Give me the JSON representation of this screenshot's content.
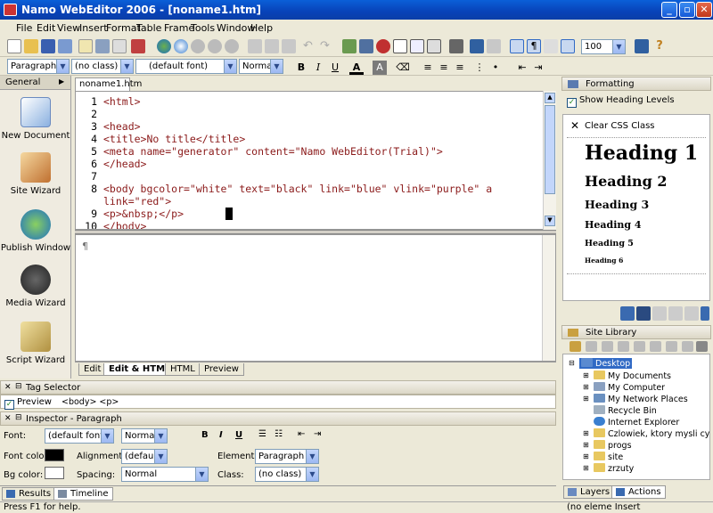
{
  "window": {
    "title": "Namo WebEditor 2006 - [noname1.htm]"
  },
  "menu": [
    "File",
    "Edit",
    "View",
    "Insert",
    "Format",
    "Table",
    "Frame",
    "Tools",
    "Window",
    "Help"
  ],
  "toolbar": {
    "zoom": "100"
  },
  "format_bar": {
    "paragraph": "Paragraph",
    "class": "(no class)",
    "font": "(default font)",
    "size": "Normal"
  },
  "left_panel": {
    "header": "General",
    "items": [
      "New Document",
      "Site Wizard",
      "Publish Window",
      "Media Wizard",
      "Script Wizard"
    ]
  },
  "document_tab": "noname1.htm",
  "code": {
    "line_numbers": [
      "1",
      "2",
      "3",
      "4",
      "5",
      "6",
      "7",
      "8",
      "",
      "9",
      "10"
    ],
    "lines": [
      "<html>",
      "",
      "<head>",
      "<title>No title</title>",
      "<meta name=\"generator\" content=\"Namo WebEditor(Trial)\">",
      "</head>",
      "",
      "<body bgcolor=\"white\" text=\"black\" link=\"blue\" vlink=\"purple\" a",
      "link=\"red\">",
      "<p>&nbsp;</p>",
      "</body>"
    ]
  },
  "design_marker": "¶",
  "mode_tabs": [
    "Edit",
    "Edit & HTML",
    "HTML",
    "Preview"
  ],
  "tag_selector": {
    "title": "Tag Selector",
    "preview_label": "Preview",
    "path": "<body> <p>"
  },
  "inspector": {
    "title": "Inspector - Paragraph",
    "font_label": "Font:",
    "font_value": "(default font)",
    "size_value": "Normal",
    "bold": "B",
    "italic": "I",
    "underline": "U",
    "font_color_label": "Font color:",
    "alignment_label": "Alignment:",
    "alignment_value": "(default)",
    "element_label": "Element:",
    "element_value": "Paragraph",
    "bg_color_label": "Bg color:",
    "spacing_label": "Spacing:",
    "spacing_value": "Normal",
    "class_label": "Class:",
    "class_value": "(no class)"
  },
  "bottom_tabs": [
    "Results",
    "Timeline"
  ],
  "status": {
    "left": "Press F1 for help.",
    "right": "(no eleme Insert"
  },
  "formatting": {
    "title": "Formatting",
    "show_heading_levels": "Show Heading Levels",
    "clear_css": "Clear CSS Class",
    "headings": [
      "Heading 1",
      "Heading 2",
      "Heading 3",
      "Heading 4",
      "Heading 5",
      "Heading 6"
    ]
  },
  "site_library": {
    "title": "Site Library",
    "tree": [
      "Desktop",
      "My Documents",
      "My Computer",
      "My Network Places",
      "Recycle Bin",
      "Internet Explorer",
      "Czlowiek, ktory mysli cyfrar",
      "progs",
      "site",
      "zrzuty"
    ]
  },
  "right_tabs": [
    "Layers",
    "Actions"
  ],
  "colors": {
    "titlebar": "#0842b8",
    "tag": "#8b1a1a",
    "attr_value": "#4a2a8a",
    "accent": "#316ac5"
  }
}
